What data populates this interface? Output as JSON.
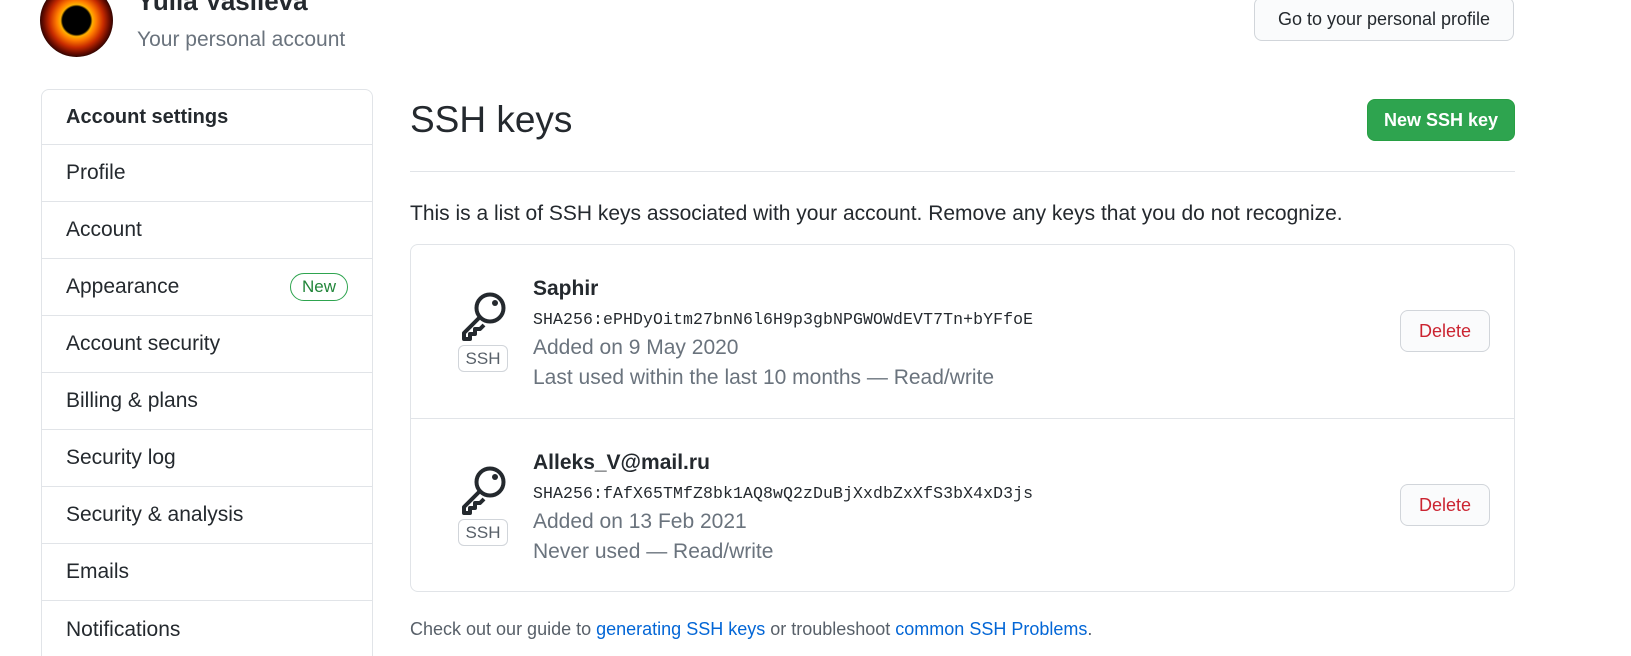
{
  "header": {
    "user_name": "Yulia Vasileva",
    "subtitle": "Your personal account",
    "profile_button": "Go to your personal profile"
  },
  "sidebar": {
    "heading": "Account settings",
    "items": [
      {
        "label": "Profile"
      },
      {
        "label": "Account"
      },
      {
        "label": "Appearance",
        "badge": "New"
      },
      {
        "label": "Account security"
      },
      {
        "label": "Billing & plans"
      },
      {
        "label": "Security log"
      },
      {
        "label": "Security & analysis"
      },
      {
        "label": "Emails"
      },
      {
        "label": "Notifications"
      }
    ]
  },
  "main": {
    "title": "SSH keys",
    "new_key_button": "New SSH key",
    "intro": "This is a list of SSH keys associated with your account. Remove any keys that you do not recognize.",
    "keys": [
      {
        "title": "Saphir",
        "type": "SSH",
        "fingerprint": "SHA256:ePHDyOitm27bnN6l6H9p3gbNPGWOWdEVT7Tn+bYFfoE",
        "added": "Added on 9 May 2020",
        "usage": "Last used within the last 10 months — Read/write",
        "delete": "Delete"
      },
      {
        "title": "Alleks_V@mail.ru",
        "type": "SSH",
        "fingerprint": "SHA256:fAfX65TMfZ8bk1AQ8wQ2zDuBjXxdbZxXfS3bX4xD3js",
        "added": "Added on 13 Feb 2021",
        "usage": "Never used — Read/write",
        "delete": "Delete"
      }
    ],
    "footer": {
      "prefix": "Check out our guide to ",
      "link1": "generating SSH keys",
      "middle": " or troubleshoot ",
      "link2": "common SSH Problems",
      "suffix": "."
    }
  },
  "colors": {
    "primary_button": "#2ea44f",
    "danger_text": "#cb2431",
    "link": "#0366d6",
    "muted_text": "#6a737d"
  },
  "icons": {
    "key": "key-icon",
    "avatar": "avatar-image"
  }
}
